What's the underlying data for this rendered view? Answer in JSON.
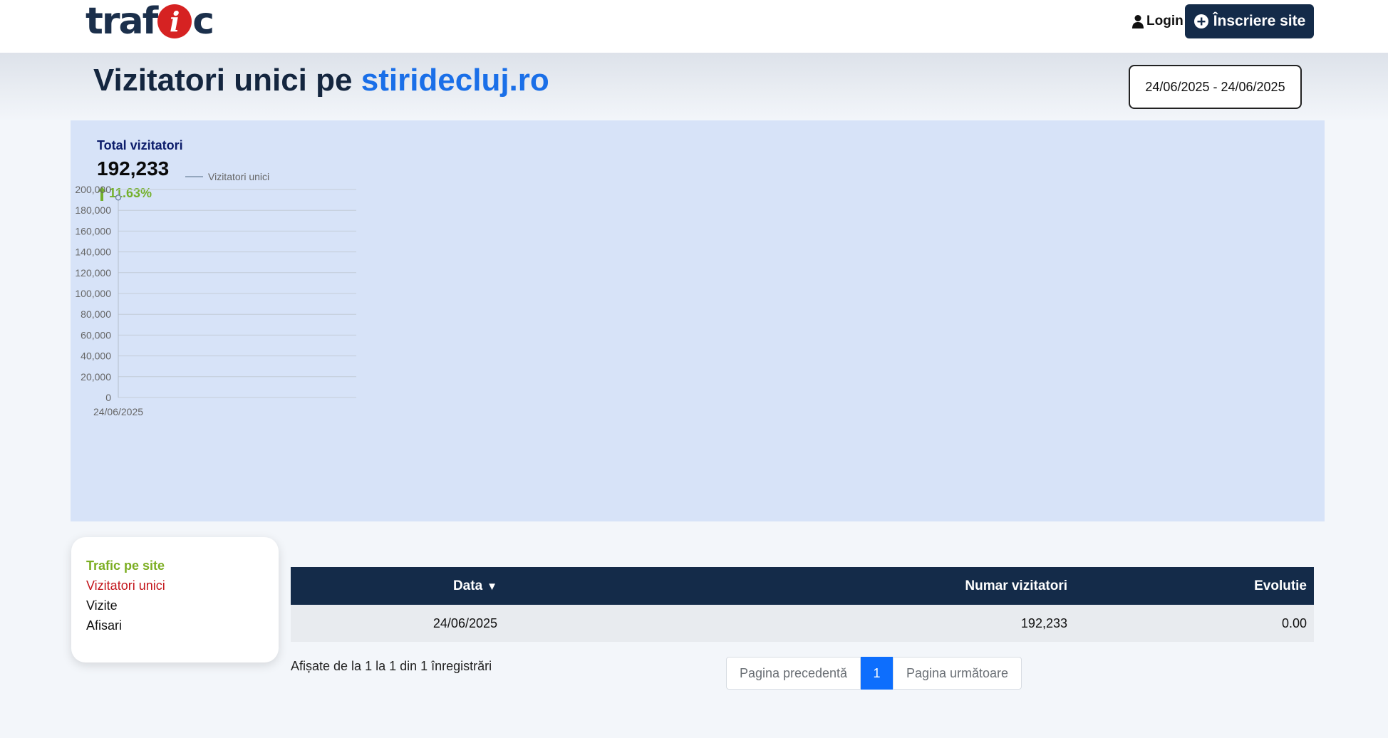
{
  "header": {
    "logo_left": "traf",
    "logo_badge": "i",
    "logo_right": "c",
    "login_label": "Login",
    "signup_label": "Înscriere site"
  },
  "page": {
    "title_prefix": "Vizitatori unici pe",
    "site_name": "stiridecluj.ro",
    "date_range": "24/06/2025 - 24/06/2025"
  },
  "summary": {
    "label": "Total vizitatori",
    "value": "192,233",
    "change": "11.63%"
  },
  "chart_data": {
    "type": "line",
    "categories": [
      "24/06/2025"
    ],
    "series": [
      {
        "name": "Vizitatori unici",
        "values": [
          192233
        ]
      }
    ],
    "ylim": [
      0,
      200000
    ],
    "yticks": [
      0,
      20000,
      40000,
      60000,
      80000,
      100000,
      120000,
      140000,
      160000,
      180000,
      200000
    ],
    "ytick_labels": [
      "0",
      "20,000",
      "40,000",
      "60,000",
      "80,000",
      "100,000",
      "120,000",
      "140,000",
      "160,000",
      "180,000",
      "200,000"
    ],
    "legend": "top",
    "grid": true
  },
  "menu": {
    "heading": "Trafic pe site",
    "items": [
      "Vizitatori unici",
      "Vizite",
      "Afisari"
    ]
  },
  "table": {
    "columns": [
      "Data",
      "Numar vizitatori",
      "Evolutie"
    ],
    "sort_indicator": "▼",
    "rows": [
      [
        "24/06/2025",
        "192,233",
        "0.00"
      ]
    ]
  },
  "pagination": {
    "info": "Afișate de la 1 la 1 din 1 înregistrări",
    "prev_label": "Pagina precedentă",
    "current": "1",
    "next_label": "Pagina următoare"
  },
  "colors": {
    "navy": "#142b49",
    "accent_blue": "#1a6fe8",
    "green": "#73b02b",
    "red": "#c3161c",
    "panel": "#d7e3f8"
  }
}
